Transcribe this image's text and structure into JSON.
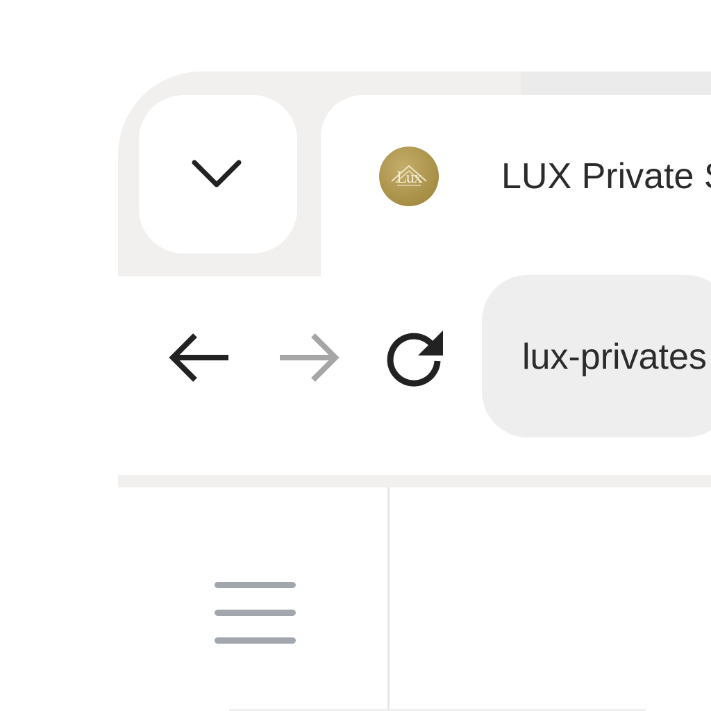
{
  "browser": {
    "tab_strip": {
      "dropdown_icon": "chevron-down-icon",
      "active_tab": {
        "favicon_icon": "lux-logo-icon",
        "favicon_text": "Lux",
        "title": "LUX Private S",
        "favicon_color": "#a68e45"
      }
    },
    "toolbar": {
      "back_icon": "arrow-left-icon",
      "forward_icon": "arrow-right-icon",
      "forward_enabled": false,
      "reload_icon": "reload-icon",
      "address_text": "lux-privates"
    },
    "content": {
      "menu_icon": "hamburger-menu-icon"
    }
  },
  "colors": {
    "tab_strip_bg": "#f2f0ee",
    "omnibox_bg": "#eeeeef",
    "icon_dark": "#222222",
    "icon_disabled": "#a6a6a6",
    "menu_icon": "#a2a7ad",
    "text": "#2b2b2b"
  }
}
